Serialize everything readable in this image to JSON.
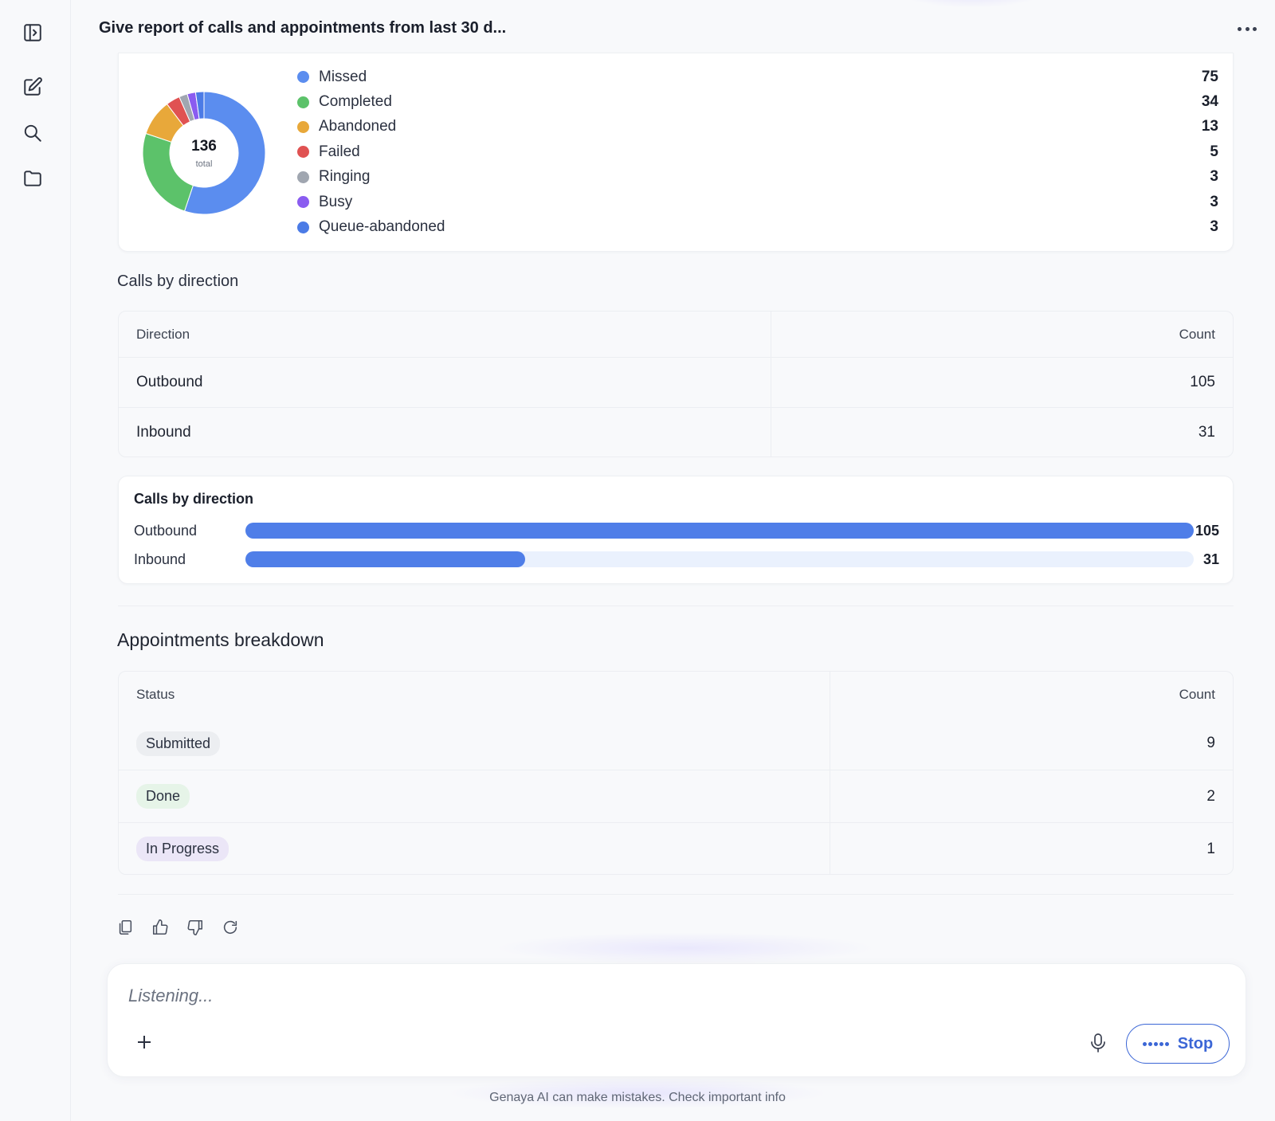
{
  "header": {
    "title": "Give report of calls and appointments from last 30 d...",
    "more_icon": "more-horizontal-icon"
  },
  "sidebar": {
    "icons": [
      "sidebar-toggle-icon",
      "new-chat-icon",
      "search-icon",
      "folder-icon"
    ]
  },
  "status_card": {
    "total": "136",
    "total_label": "total",
    "items": [
      {
        "label": "Missed",
        "value": "75",
        "color": "#5b8def"
      },
      {
        "label": "Completed",
        "value": "34",
        "color": "#5cc26a"
      },
      {
        "label": "Abandoned",
        "value": "13",
        "color": "#e8a83a"
      },
      {
        "label": "Failed",
        "value": "5",
        "color": "#e05252"
      },
      {
        "label": "Ringing",
        "value": "3",
        "color": "#a0a6b0"
      },
      {
        "label": "Busy",
        "value": "3",
        "color": "#8a5cf0"
      },
      {
        "label": "Queue-abandoned",
        "value": "3",
        "color": "#4b7be6"
      }
    ]
  },
  "calls_direction_table": {
    "heading": "Calls by direction",
    "columns": [
      "Direction",
      "Count"
    ],
    "rows": [
      [
        "Outbound",
        "105"
      ],
      [
        "Inbound",
        "31"
      ]
    ]
  },
  "calls_direction_chart": {
    "title": "Calls by direction"
  },
  "chart_data": [
    {
      "type": "pie",
      "categories": [
        "Missed",
        "Completed",
        "Abandoned",
        "Failed",
        "Ringing",
        "Busy",
        "Queue-abandoned"
      ],
      "values": [
        75,
        34,
        13,
        5,
        3,
        3,
        3
      ],
      "colors": [
        "#5b8def",
        "#5cc26a",
        "#e8a83a",
        "#e05252",
        "#a0a6b0",
        "#8a5cf0",
        "#4b7be6"
      ],
      "center_label": "136 total",
      "legend": "right"
    },
    {
      "type": "bar",
      "orientation": "horizontal",
      "title": "Calls by direction",
      "categories": [
        "Outbound",
        "Inbound"
      ],
      "values": [
        105,
        31
      ],
      "xlim": [
        0,
        105
      ],
      "color": "#4f7ee8"
    }
  ],
  "appointments": {
    "heading": "Appointments breakdown",
    "columns": [
      "Status",
      "Count"
    ],
    "rows": [
      {
        "status": "Submitted",
        "count": "9",
        "pill_color": "#eceef1"
      },
      {
        "status": "Done",
        "count": "2",
        "pill_color": "#e6f4e8"
      },
      {
        "status": "In Progress",
        "count": "1",
        "pill_color": "#ebe6f7"
      }
    ]
  },
  "message_actions": [
    "copy-icon",
    "thumbs-up-icon",
    "thumbs-down-icon",
    "regenerate-icon"
  ],
  "composer": {
    "placeholder": "Listening...",
    "stop_label": "Stop"
  },
  "footer": {
    "disclaimer": "Genaya AI can make mistakes. Check important info"
  }
}
